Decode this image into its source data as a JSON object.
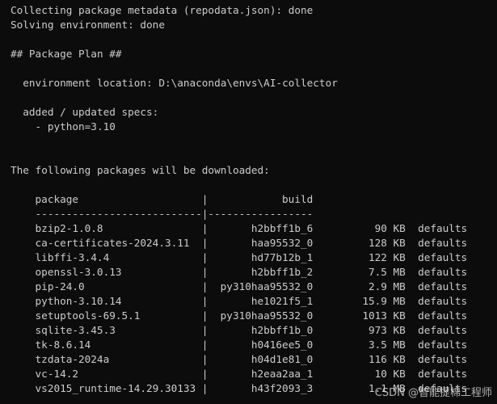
{
  "lines": {
    "collecting": "Collecting package metadata (repodata.json): done",
    "solving": "Solving environment: done",
    "plan_header": "## Package Plan ##",
    "env_location": "  environment location: D:\\anaconda\\envs\\AI-collector",
    "specs_header": "  added / updated specs:",
    "spec_1": "    - python=3.10",
    "download_header": "The following packages will be downloaded:"
  },
  "table": {
    "header_package": "package",
    "header_build": "build",
    "bar": "|",
    "dash_package": "---------------------------",
    "dash_build": "-----------------",
    "rows": [
      {
        "package": "bzip2-1.0.8",
        "build": "h2bbff1b_6",
        "size": "90 KB",
        "channel": "defaults"
      },
      {
        "package": "ca-certificates-2024.3.11",
        "build": "haa95532_0",
        "size": "128 KB",
        "channel": "defaults"
      },
      {
        "package": "libffi-3.4.4",
        "build": "hd77b12b_1",
        "size": "122 KB",
        "channel": "defaults"
      },
      {
        "package": "openssl-3.0.13",
        "build": "h2bbff1b_2",
        "size": "7.5 MB",
        "channel": "defaults"
      },
      {
        "package": "pip-24.0",
        "build": "py310haa95532_0",
        "size": "2.9 MB",
        "channel": "defaults"
      },
      {
        "package": "python-3.10.14",
        "build": "he1021f5_1",
        "size": "15.9 MB",
        "channel": "defaults"
      },
      {
        "package": "setuptools-69.5.1",
        "build": "py310haa95532_0",
        "size": "1013 KB",
        "channel": "defaults"
      },
      {
        "package": "sqlite-3.45.3",
        "build": "h2bbff1b_0",
        "size": "973 KB",
        "channel": "defaults"
      },
      {
        "package": "tk-8.6.14",
        "build": "h0416ee5_0",
        "size": "3.5 MB",
        "channel": "defaults"
      },
      {
        "package": "tzdata-2024a",
        "build": "h04d1e81_0",
        "size": "116 KB",
        "channel": "defaults"
      },
      {
        "package": "vc-14.2",
        "build": "h2eaa2aa_1",
        "size": "10 KB",
        "channel": "defaults"
      },
      {
        "package": "vs2015_runtime-14.29.30133",
        "build": "h43f2093_3",
        "size": "1.1 MB",
        "channel": "defaults"
      }
    ]
  },
  "watermark": "CSDN @智能提棉工程师",
  "colors": {
    "background": "#0c0c0c",
    "text": "#cccccc"
  }
}
